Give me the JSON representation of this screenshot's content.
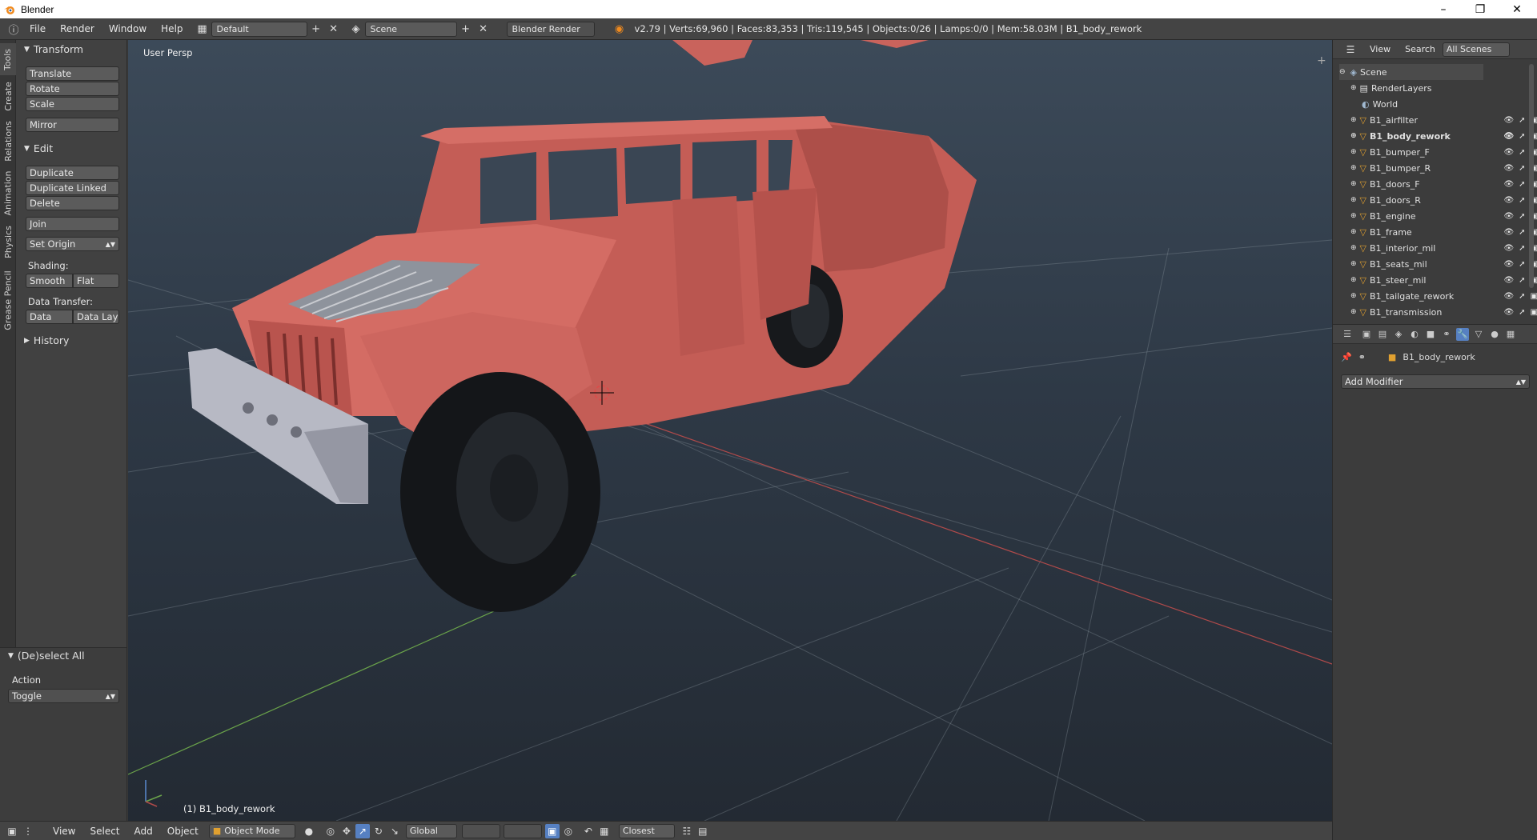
{
  "window": {
    "title": "Blender"
  },
  "info": {
    "menus": [
      "File",
      "Render",
      "Window",
      "Help"
    ],
    "layout": "Default",
    "scene": "Scene",
    "engine": "Blender Render",
    "stats": "v2.79 | Verts:69,960 | Faces:83,353 | Tris:119,545 | Objects:0/26 | Lamps:0/0 | Mem:58.03M | B1_body_rework"
  },
  "tool_tabs": [
    "Tools",
    "Create",
    "Relations",
    "Animation",
    "Physics",
    "Grease Pencil"
  ],
  "tools": {
    "transform_header": "Transform",
    "translate": "Translate",
    "rotate": "Rotate",
    "scale": "Scale",
    "mirror": "Mirror",
    "edit_header": "Edit",
    "duplicate": "Duplicate",
    "duplicate_linked": "Duplicate Linked",
    "delete": "Delete",
    "join": "Join",
    "set_origin": "Set Origin",
    "shading_label": "Shading:",
    "smooth": "Smooth",
    "flat": "Flat",
    "data_transfer_label": "Data Transfer:",
    "data": "Data",
    "data_layout": "Data Layo",
    "history_header": "History"
  },
  "operator": {
    "header": "(De)select All",
    "action_label": "Action",
    "action_value": "Toggle"
  },
  "viewport": {
    "view_name": "User Persp",
    "object_info": "(1) B1_body_rework"
  },
  "bottom": {
    "menus": [
      "View",
      "Select",
      "Add",
      "Object"
    ],
    "mode": "Object Mode",
    "orientation": "Global",
    "snap_target": "Closest"
  },
  "outliner": {
    "view": "View",
    "search": "Search",
    "display": "All Scenes",
    "scene": "Scene",
    "render_layers": "RenderLayers",
    "world": "World",
    "objects": [
      {
        "name": "B1_airfilter",
        "selected": false
      },
      {
        "name": "B1_body_rework",
        "selected": true
      },
      {
        "name": "B1_bumper_F",
        "selected": false
      },
      {
        "name": "B1_bumper_R",
        "selected": false
      },
      {
        "name": "B1_doors_F",
        "selected": false
      },
      {
        "name": "B1_doors_R",
        "selected": false
      },
      {
        "name": "B1_engine",
        "selected": false
      },
      {
        "name": "B1_frame",
        "selected": false
      },
      {
        "name": "B1_interior_mil",
        "selected": false
      },
      {
        "name": "B1_seats_mil",
        "selected": false
      },
      {
        "name": "B1_steer_mil",
        "selected": false
      },
      {
        "name": "B1_tailgate_rework",
        "selected": false
      },
      {
        "name": "B1_transmission",
        "selected": false
      }
    ]
  },
  "properties": {
    "object_name": "B1_body_rework",
    "add_modifier": "Add Modifier"
  },
  "colors": {
    "accent": "#5680c2",
    "car_body": "#c9635c",
    "ui_dark": "#3c3c3c"
  }
}
